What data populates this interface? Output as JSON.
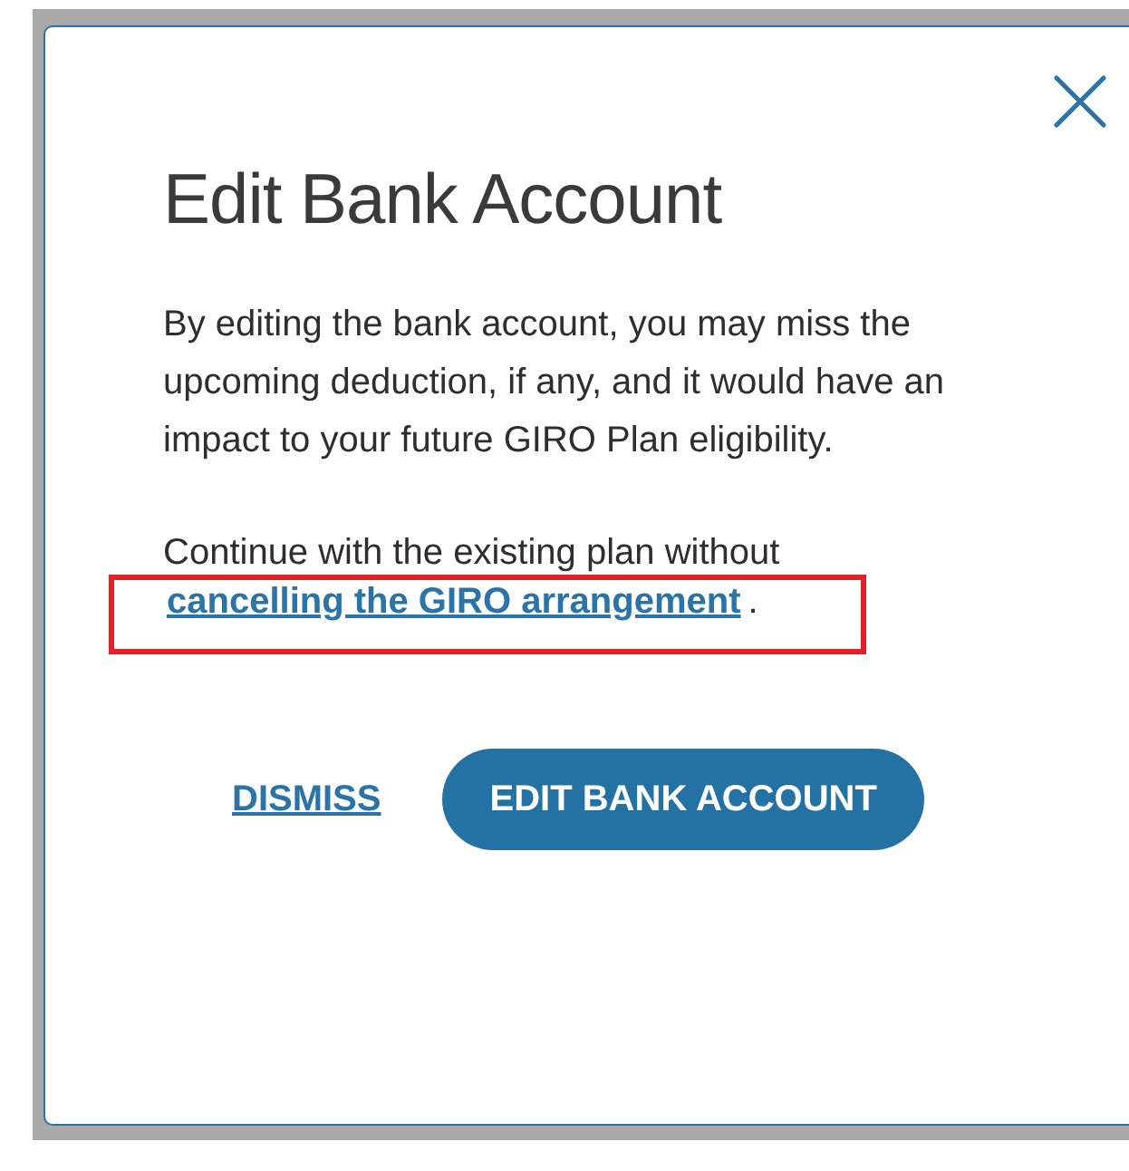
{
  "dialog": {
    "title": "Edit Bank Account",
    "message": "By editing the bank account, you may miss the upcoming deduction, if any, and it would have an impact to your future GIRO Plan eligibility.",
    "continue_text": "Continue with the existing plan without",
    "link": {
      "label": "cancelling the GIRO arrangement",
      "highlighted": true
    },
    "link_suffix": ".",
    "buttons": [
      {
        "label": "DISMISS",
        "kind": "link"
      },
      {
        "label": "EDIT BANK ACCOUNT",
        "kind": "primary"
      }
    ]
  }
}
